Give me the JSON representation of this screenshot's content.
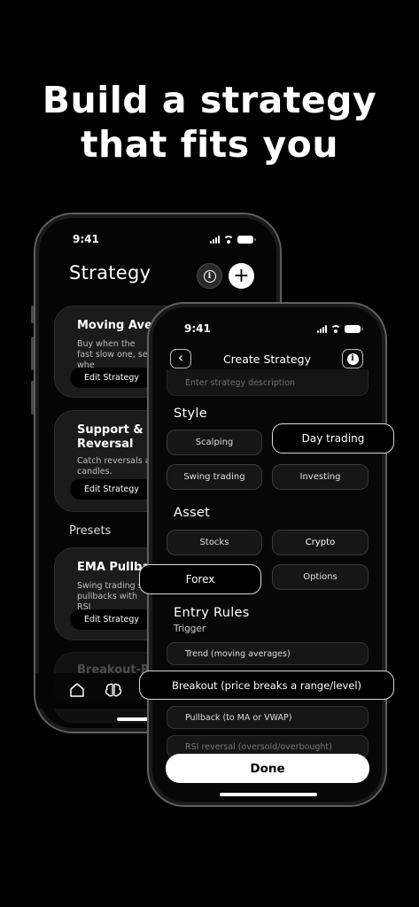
{
  "headline": {
    "line1": "Build a strategy",
    "line2": "that fits you"
  },
  "back_phone": {
    "time": "9:41",
    "title": "Strategy",
    "info_label": "i",
    "add_label": "+",
    "cards": [
      {
        "title": "Moving Avera",
        "desc": "Buy when the fast slow one, sell whe",
        "button": "Edit Strategy"
      },
      {
        "title": "Support & R",
        "title2": "Reversal",
        "desc": "Catch reversals a candles.",
        "button": "Edit Strategy"
      }
    ],
    "presets_label": "Presets",
    "preset_cards": [
      {
        "title": "EMA Pullbac",
        "desc": "Swing trading st pullbacks with RSI",
        "button": "Edit Strategy"
      },
      {
        "title": "Breakout-R"
      }
    ]
  },
  "front_phone": {
    "time": "9:41",
    "back_glyph": "‹",
    "title": "Create Strategy",
    "info_label": "i",
    "description_placeholder": "Enter strategy description",
    "style": {
      "label": "Style",
      "options": [
        "Scalping",
        "Day trading",
        "Swing trading",
        "Investing"
      ],
      "selected": "Day trading"
    },
    "asset": {
      "label": "Asset",
      "options": [
        "Stocks",
        "Crypto",
        "Forex",
        "Options"
      ],
      "selected": "Forex"
    },
    "entry_rules": {
      "label": "Entry Rules",
      "trigger_label": "Trigger",
      "options": [
        "Trend (moving averages)",
        "Breakout (price breaks a range/level)",
        "Pullback (to MA or VWAP)",
        "RSI reversal (oversold/overbought)"
      ],
      "selected": "Breakout (price breaks a range/level)"
    },
    "done_label": "Done"
  }
}
